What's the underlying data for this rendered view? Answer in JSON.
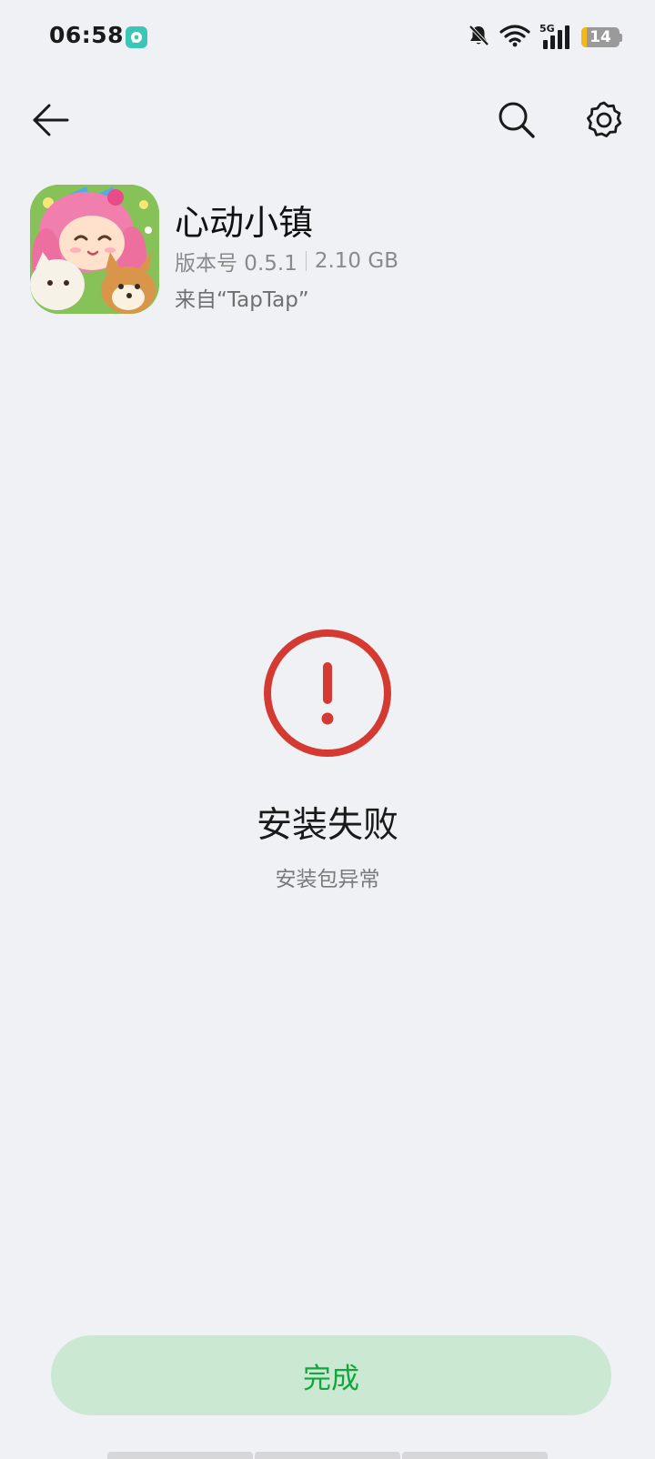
{
  "status_bar": {
    "time": "06:58",
    "network": "5G",
    "battery": 14
  },
  "toolbar": {
    "back_icon": "back-arrow-icon",
    "search_icon": "search-icon",
    "settings_icon": "gear-icon"
  },
  "app": {
    "name": "心动小镇",
    "version": "版本号 0.5.1",
    "size": "2.10 GB",
    "source": "来自“TapTap”"
  },
  "result": {
    "icon": "error-exclamation-icon",
    "title": "安装失败",
    "message": "安装包异常",
    "accent_color": "#d53a32"
  },
  "actions": {
    "done_label": "完成",
    "done_color": "#13a63a"
  }
}
